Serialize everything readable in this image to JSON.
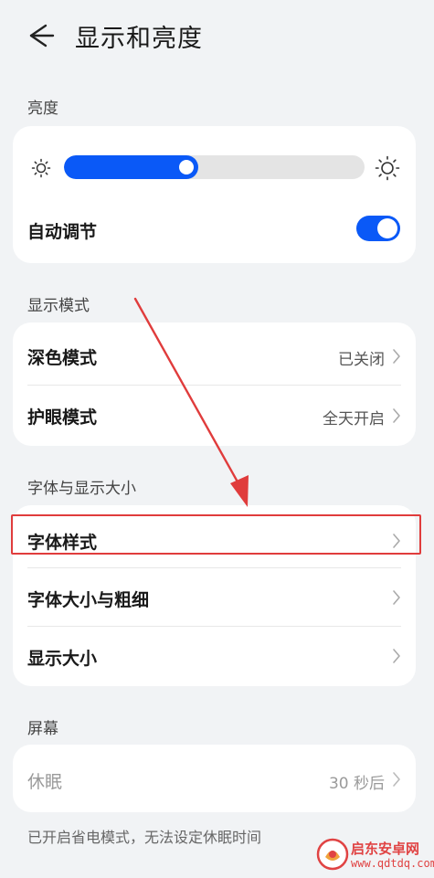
{
  "header": {
    "title": "显示和亮度",
    "back_icon": "arrow-left-icon"
  },
  "brightness": {
    "section_title": "亮度",
    "level": 0.41,
    "auto_label": "自动调节",
    "auto_on": true,
    "accent": "#0a59f7"
  },
  "display_mode": {
    "section_title": "显示模式",
    "rows": [
      {
        "label": "深色模式",
        "value": "已关闭"
      },
      {
        "label": "护眼模式",
        "value": "全天开启"
      }
    ]
  },
  "font_display": {
    "section_title": "字体与显示大小",
    "rows": [
      {
        "label": "字体样式"
      },
      {
        "label": "字体大小与粗细"
      },
      {
        "label": "显示大小"
      }
    ]
  },
  "screen": {
    "section_title": "屏幕",
    "rows": [
      {
        "label": "休眠",
        "value": "30 秒后"
      }
    ],
    "note": "已开启省电模式，无法设定休眠时间"
  },
  "watermark": {
    "line1": "启东安卓网",
    "line2": "www.qdtdq.com"
  },
  "annotation_color": "#e03c3c"
}
